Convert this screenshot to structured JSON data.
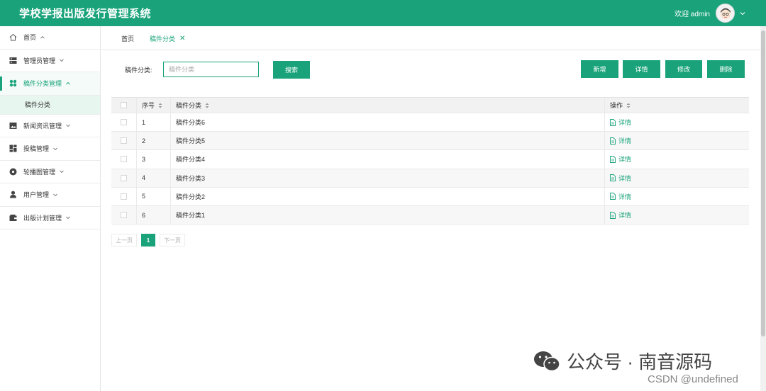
{
  "header": {
    "title": "学校学报出版发行管理系统",
    "welcome": "欢迎 admin"
  },
  "sidebar": {
    "items": [
      {
        "label": "首页",
        "icon": "home-icon"
      },
      {
        "label": "管理员管理",
        "icon": "server-icon"
      },
      {
        "label": "稿件分类管理",
        "icon": "grid-icon",
        "active": true,
        "sub": [
          {
            "label": "稿件分类"
          }
        ]
      },
      {
        "label": "新闻资讯管理",
        "icon": "image-icon"
      },
      {
        "label": "投稿管理",
        "icon": "dashboard-icon"
      },
      {
        "label": "轮播图管理",
        "icon": "disc-icon"
      },
      {
        "label": "用户管理",
        "icon": "user-icon"
      },
      {
        "label": "出版计划管理",
        "icon": "wallet-icon"
      }
    ]
  },
  "tabs": [
    {
      "label": "首页"
    },
    {
      "label": "稿件分类",
      "close": "✕"
    }
  ],
  "search": {
    "label": "稿件分类:",
    "placeholder": "稿件分类",
    "button": "搜索"
  },
  "actions": {
    "add": "新增",
    "detail": "详情",
    "edit": "修改",
    "delete": "删除"
  },
  "table": {
    "headers": {
      "index": "序号",
      "category": "稿件分类",
      "op": "操作"
    },
    "rows": [
      {
        "index": "1",
        "category": "稿件分类6",
        "op": "详情"
      },
      {
        "index": "2",
        "category": "稿件分类5",
        "op": "详情"
      },
      {
        "index": "3",
        "category": "稿件分类4",
        "op": "详情"
      },
      {
        "index": "4",
        "category": "稿件分类3",
        "op": "详情"
      },
      {
        "index": "5",
        "category": "稿件分类2",
        "op": "详情"
      },
      {
        "index": "6",
        "category": "稿件分类1",
        "op": "详情"
      }
    ]
  },
  "pagination": {
    "prev": "上一页",
    "current": "1",
    "next": "下一页"
  },
  "watermark": {
    "text": "公众号 · 南音源码",
    "csdn": "CSDN @undefined"
  },
  "colors": {
    "accent": "#1aa37a"
  }
}
